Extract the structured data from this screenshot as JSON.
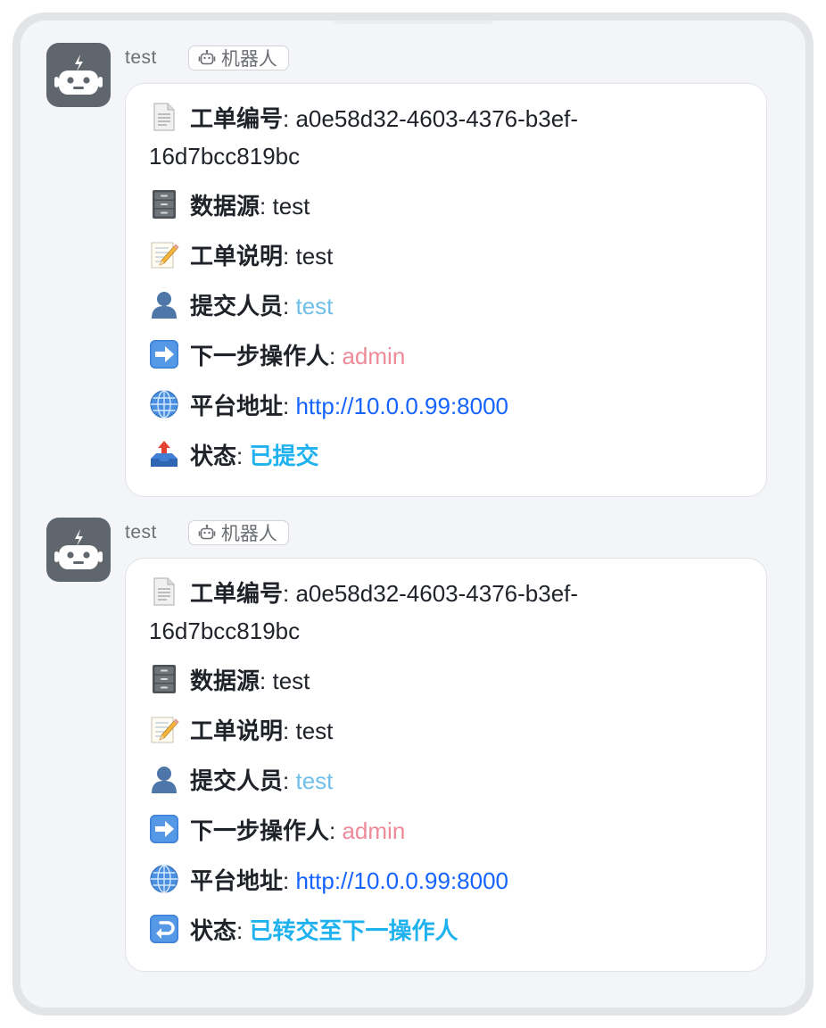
{
  "messages": [
    {
      "sender": "test",
      "badge": "机器人",
      "fields": {
        "ticket_id": {
          "key": "工单编号",
          "value": "a0e58d32-4603-4376-b3ef-16d7bcc819bc"
        },
        "datasource": {
          "key": "数据源",
          "value": "test"
        },
        "description": {
          "key": "工单说明",
          "value": "test"
        },
        "submitter": {
          "key": "提交人员",
          "value": "test"
        },
        "next_operator": {
          "key": "下一步操作人",
          "value": "admin"
        },
        "platform_url": {
          "key": "平台地址",
          "value": "http://10.0.0.99:8000"
        },
        "status": {
          "key": "状态",
          "value": "已提交"
        }
      },
      "icons": {
        "ticket_id": "page-icon",
        "datasource": "file-cabinet-icon",
        "description": "memo-icon",
        "submitter": "person-silhouette-icon",
        "next_operator": "right-arrow-icon",
        "platform_url": "globe-icon",
        "status": "outbox-tray-icon"
      }
    },
    {
      "sender": "test",
      "badge": "机器人",
      "fields": {
        "ticket_id": {
          "key": "工单编号",
          "value": "a0e58d32-4603-4376-b3ef-16d7bcc819bc"
        },
        "datasource": {
          "key": "数据源",
          "value": "test"
        },
        "description": {
          "key": "工单说明",
          "value": "test"
        },
        "submitter": {
          "key": "提交人员",
          "value": "test"
        },
        "next_operator": {
          "key": "下一步操作人",
          "value": "admin"
        },
        "platform_url": {
          "key": "平台地址",
          "value": "http://10.0.0.99:8000"
        },
        "status": {
          "key": "状态",
          "value": "已转交至下一操作人"
        }
      },
      "icons": {
        "ticket_id": "page-icon",
        "datasource": "file-cabinet-icon",
        "description": "memo-icon",
        "submitter": "person-silhouette-icon",
        "next_operator": "right-arrow-icon",
        "platform_url": "globe-icon",
        "status": "return-arrow-icon"
      }
    }
  ],
  "colors": {
    "submitter_value": "#6fbfe8",
    "operator_value": "#ee8a9a",
    "link": "#1664ff",
    "status": "#1fb2ee",
    "avatar_bg": "#5f666d"
  }
}
